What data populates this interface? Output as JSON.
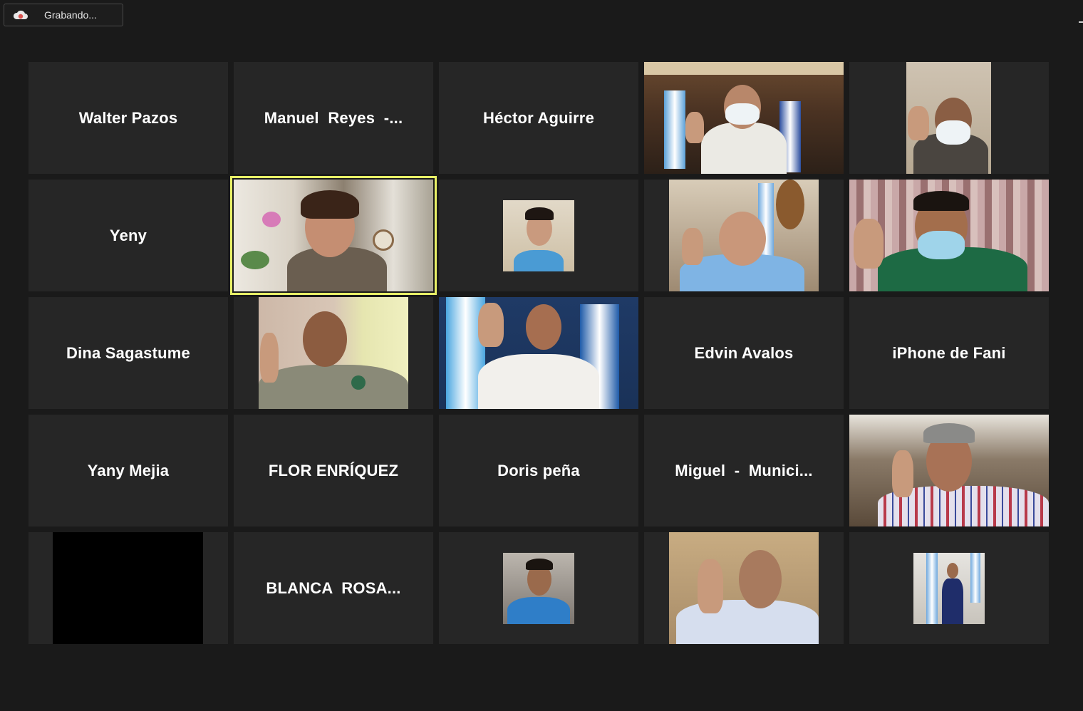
{
  "recording": {
    "label": "Grabando...",
    "icon": "cloud-record-icon",
    "icon_color": "#d9534f"
  },
  "colors": {
    "tile_bg": "#262626",
    "page_bg": "#1a1a1a",
    "active_speaker_border": "#e8f067"
  },
  "participants": [
    {
      "name": "Walter Pazos",
      "video": false
    },
    {
      "name": "Manuel  Reyes  -...",
      "video": false
    },
    {
      "name": "Héctor Aguirre",
      "video": false
    },
    {
      "name": "",
      "video": true
    },
    {
      "name": "",
      "video": true
    },
    {
      "name": "Yeny",
      "video": false
    },
    {
      "name": "",
      "video": true,
      "active_speaker": true
    },
    {
      "name": "",
      "video": true
    },
    {
      "name": "",
      "video": true
    },
    {
      "name": "",
      "video": true
    },
    {
      "name": "Dina Sagastume",
      "video": false
    },
    {
      "name": "",
      "video": true
    },
    {
      "name": "",
      "video": true
    },
    {
      "name": "Edvin Avalos",
      "video": false
    },
    {
      "name": "iPhone de Fani",
      "video": false
    },
    {
      "name": "Yany Mejia",
      "video": false
    },
    {
      "name": "FLOR ENRÍQUEZ",
      "video": false
    },
    {
      "name": "Doris peña",
      "video": false
    },
    {
      "name": "Miguel  -  Munici...",
      "video": false
    },
    {
      "name": "",
      "video": true
    },
    {
      "name": "",
      "video": true,
      "black": true
    },
    {
      "name": "BLANCA  ROSA...",
      "video": false
    },
    {
      "name": "",
      "video": true
    },
    {
      "name": "",
      "video": true
    },
    {
      "name": "",
      "video": true
    }
  ]
}
